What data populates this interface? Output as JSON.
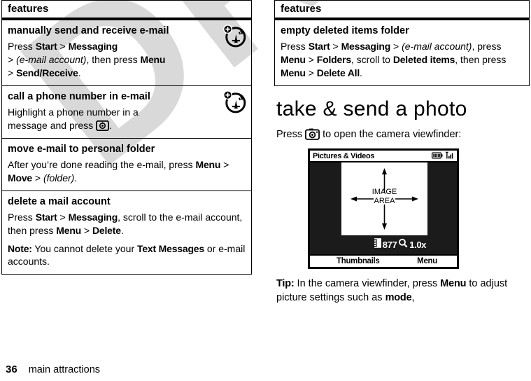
{
  "watermark": {
    "text": "DRAFT"
  },
  "left_column": {
    "table": {
      "header": "features",
      "rows": [
        {
          "title": "manually send and receive e-mail",
          "icon": "network-antenna-icon",
          "body_html": "Press <b>Start</b> &gt; <b>Messaging</b><br>&gt; <i>(e-mail account)</i>, then press <b>Menu</b><br>&gt; <b>Send/Receive</b>."
        },
        {
          "title": "call a phone number in e-mail",
          "icon": "network-antenna-icon",
          "body_html": "Highlight a phone number in a<br>message and press <span class=\"keyglyph\"></span>."
        },
        {
          "title": "move e-mail to personal folder",
          "icon": "",
          "body_html": "After you&rsquo;re done reading the e-mail, press <b>Menu</b> &gt; <b>Move</b> &gt; <i>(folder)</i>."
        },
        {
          "title": "delete a mail account",
          "icon": "",
          "body_html": "Press <b>Start</b> &gt; <b>Messaging</b>, scroll to the e-mail account, then press <b>Menu</b> &gt; <b>Delete</b>.",
          "body_html2": "<b>Note:</b> You cannot delete your <b>Text Messages</b> or e-mail accounts."
        }
      ]
    }
  },
  "right_column": {
    "table": {
      "header": "features",
      "rows": [
        {
          "title": "empty deleted items folder",
          "body_html": "Press <b>Start</b> &gt; <b>Messaging</b> &gt; <i>(e-mail account)</i>, press <b>Menu</b> &gt; <b>Folders</b>, scroll to <b>Deleted items</b>, then press <b>Menu</b> &gt; <b>Delete All</b>."
        }
      ]
    },
    "section_heading": "take & send a photo",
    "intro_prefix": "Press",
    "intro_suffix": "to open the camera viewfinder:",
    "tip_html": "<b>Tip:</b> In the camera viewfinder, press <b>Menu</b> to adjust picture settings such as <b>mode</b>,"
  },
  "phone_mockup": {
    "title": "Pictures & Videos",
    "status_icons": [
      "battery-icon",
      "signal-icon"
    ],
    "image_area_line1": "IMAGE",
    "image_area_line2": "AREA",
    "counter": "877",
    "counter_icon": "film-strip-icon",
    "zoom_icon": "magnifier-icon",
    "zoom_value": "1.0x",
    "softkey_left": "Thumbnails",
    "softkey_right": "Menu"
  },
  "footer": {
    "page_number": "36",
    "page_title": "main attractions"
  },
  "colors": {
    "ink": "#000000",
    "paper": "#ffffff",
    "watermark": "#d9d9d9",
    "screen_bg": "#1b1b1b"
  }
}
